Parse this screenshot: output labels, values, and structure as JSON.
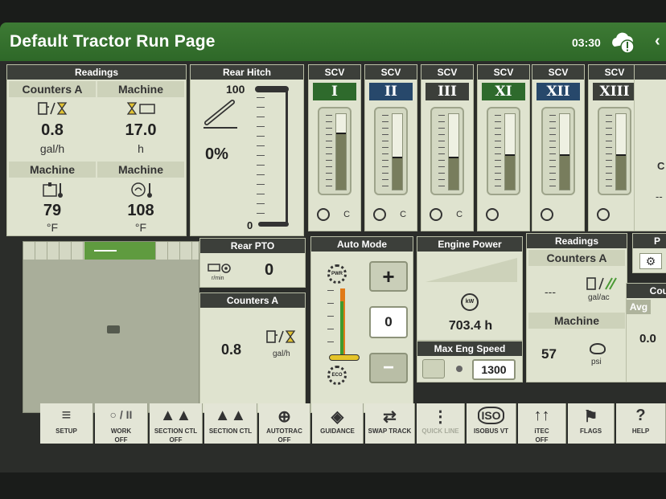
{
  "header": {
    "title": "Default Tractor Run Page",
    "time": "03:30"
  },
  "readings_panel": {
    "title": "Readings",
    "cells": [
      {
        "label": "Counters A",
        "value": "0.8",
        "unit": "gal/h"
      },
      {
        "label": "Machine",
        "value": "17.0",
        "unit": "h"
      },
      {
        "label": "Machine",
        "value": "79",
        "unit": "°F"
      },
      {
        "label": "Machine",
        "value": "108",
        "unit": "°F"
      }
    ]
  },
  "rear_hitch": {
    "title": "Rear Hitch",
    "percent": "0%",
    "top_label": "100",
    "bottom_label": "0"
  },
  "scv": [
    {
      "label": "SCV",
      "id": "I",
      "color": "#2e6a2c",
      "fill_pct": 76,
      "foot": "C"
    },
    {
      "label": "SCV",
      "id": "II",
      "color": "#27486b",
      "fill_pct": 44,
      "foot": "C"
    },
    {
      "label": "SCV",
      "id": "III",
      "color": "#3c3f3a",
      "fill_pct": 44,
      "foot": "C"
    },
    {
      "label": "SCV",
      "id": "XI",
      "color": "#2e6a2c",
      "fill_pct": 47,
      "foot": ""
    },
    {
      "label": "SCV",
      "id": "XII",
      "color": "#27486b",
      "fill_pct": 47,
      "foot": ""
    },
    {
      "label": "SCV",
      "id": "XIII",
      "color": "#3c3f3a",
      "fill_pct": 47,
      "foot": ""
    }
  ],
  "rear_pto": {
    "title": "Rear PTO",
    "value": "0",
    "unit": "r/min"
  },
  "counters_a_panel": {
    "title": "Counters A",
    "value": "0.8",
    "unit": "gal/h"
  },
  "auto_mode": {
    "title": "Auto Mode",
    "value": "0",
    "plus": "+",
    "minus": "−",
    "top_icon": "PWR",
    "bottom_icon": "ECO"
  },
  "engine_power": {
    "title": "Engine Power",
    "value": "703.4 h",
    "icon_label": "kW"
  },
  "max_eng_speed": {
    "title": "Max Eng Speed",
    "value": "1300"
  },
  "readings_panel2": {
    "title": "Readings",
    "sub1": "Counters A",
    "dash": "---",
    "unit1": "gal/ac",
    "sub2": "Machine",
    "value2": "57",
    "unit2": "psi"
  },
  "right_edge": {
    "avg": "Avg",
    "value": "0.0",
    "cou": "Cou",
    "p": "P",
    "c": "C",
    "dash": "--"
  },
  "bottom_bar": [
    {
      "label": "SETUP",
      "state": ""
    },
    {
      "label": "WORK",
      "state": "OFF"
    },
    {
      "label": "SECTION CTL",
      "state": "OFF"
    },
    {
      "label": "SECTION CTL",
      "state": ""
    },
    {
      "label": "AUTOTRAC",
      "state": "OFF"
    },
    {
      "label": "GUIDANCE",
      "state": ""
    },
    {
      "label": "SWAP TRACK",
      "state": ""
    },
    {
      "label": "QUICK LINE",
      "state": ""
    },
    {
      "label": "ISOBUS VT",
      "state": ""
    },
    {
      "label": "iTEC",
      "state": "OFF"
    },
    {
      "label": "FLAGS",
      "state": ""
    },
    {
      "label": "HELP",
      "state": ""
    }
  ],
  "work_icon_text": "○ / II",
  "iso_text": "ISO"
}
